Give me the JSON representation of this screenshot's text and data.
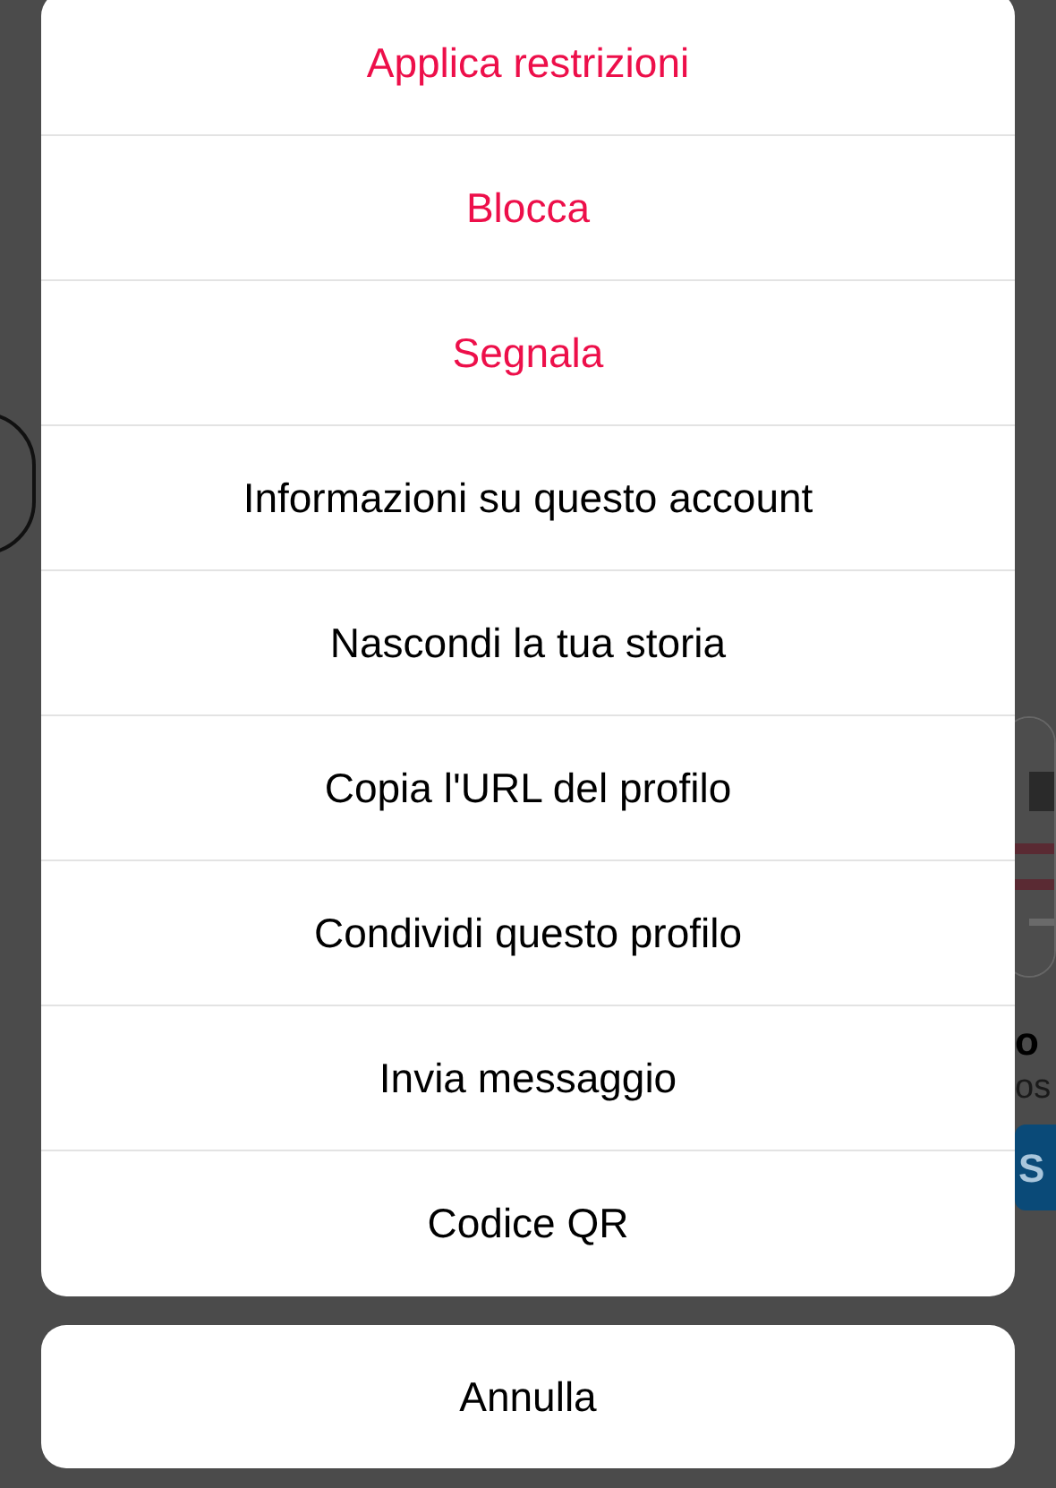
{
  "background": {
    "suggested_card": {
      "name": "o",
      "subtitle": "os",
      "button": "S"
    }
  },
  "actions": [
    {
      "label": "Applica restrizioni",
      "destructive": true
    },
    {
      "label": "Blocca",
      "destructive": true
    },
    {
      "label": "Segnala",
      "destructive": true
    },
    {
      "label": "Informazioni su questo account",
      "destructive": false
    },
    {
      "label": "Nascondi la tua storia",
      "destructive": false
    },
    {
      "label": "Copia l'URL del profilo",
      "destructive": false
    },
    {
      "label": "Condividi questo profilo",
      "destructive": false
    },
    {
      "label": "Invia messaggio",
      "destructive": false
    },
    {
      "label": "Codice QR",
      "destructive": false
    }
  ],
  "cancel": {
    "label": "Annulla"
  }
}
